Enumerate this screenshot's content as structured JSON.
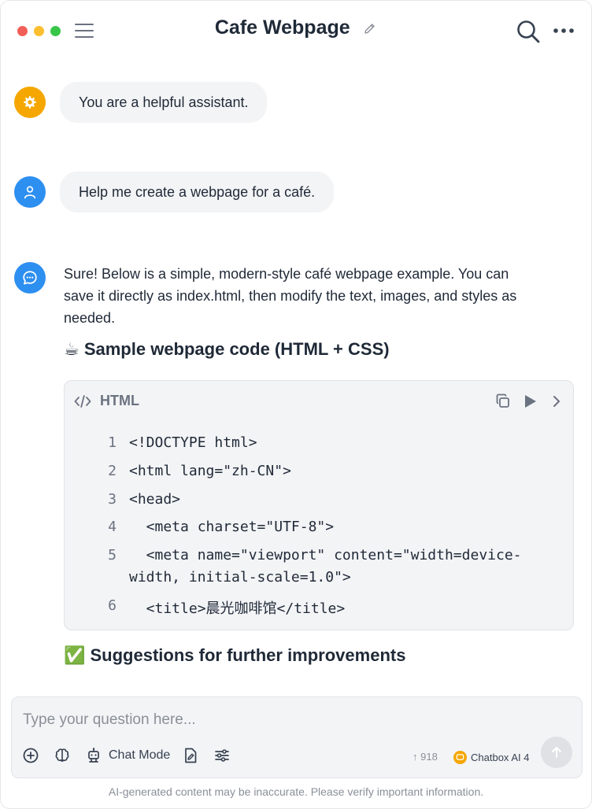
{
  "window": {
    "title": "Cafe Webpage"
  },
  "messages": {
    "system": "You are a helpful assistant.",
    "user": "Help me create a webpage for a café.",
    "assistant_line1": "Sure! Below is a simple, modern-style café webpage example. You can",
    "assistant_line2": "save it directly as index.html, then modify the text, images, and styles as",
    "assistant_line3": "needed.",
    "heading_code": "☕ Sample webpage code (HTML + CSS)",
    "heading_suggestions": "✅ Suggestions for further improvements"
  },
  "codeblock": {
    "language": "HTML",
    "lines": [
      {
        "n": "1",
        "text": "<!DOCTYPE html>"
      },
      {
        "n": "2",
        "text": "<html lang=\"zh-CN\">"
      },
      {
        "n": "3",
        "text": "<head>"
      },
      {
        "n": "4",
        "text": "  <meta charset=\"UTF-8\">"
      },
      {
        "n": "5",
        "text": "  <meta name=\"viewport\" content=\"width=device-"
      },
      {
        "n": "",
        "text": "width, initial-scale=1.0\">"
      },
      {
        "n": "6",
        "text": "  <title>晨光咖啡馆</title>"
      }
    ]
  },
  "composer": {
    "placeholder": "Type your question here...",
    "chat_mode_label": "Chat Mode",
    "token_count": "↑ 918",
    "model_name": "Chatbox AI 4"
  },
  "footer": {
    "disclaimer": "AI-generated content may be inaccurate. Please verify important information."
  },
  "colors": {
    "system_avatar": "#f5a700",
    "user_avatar": "#2d8ff0",
    "accent": "#2d8ff0"
  }
}
